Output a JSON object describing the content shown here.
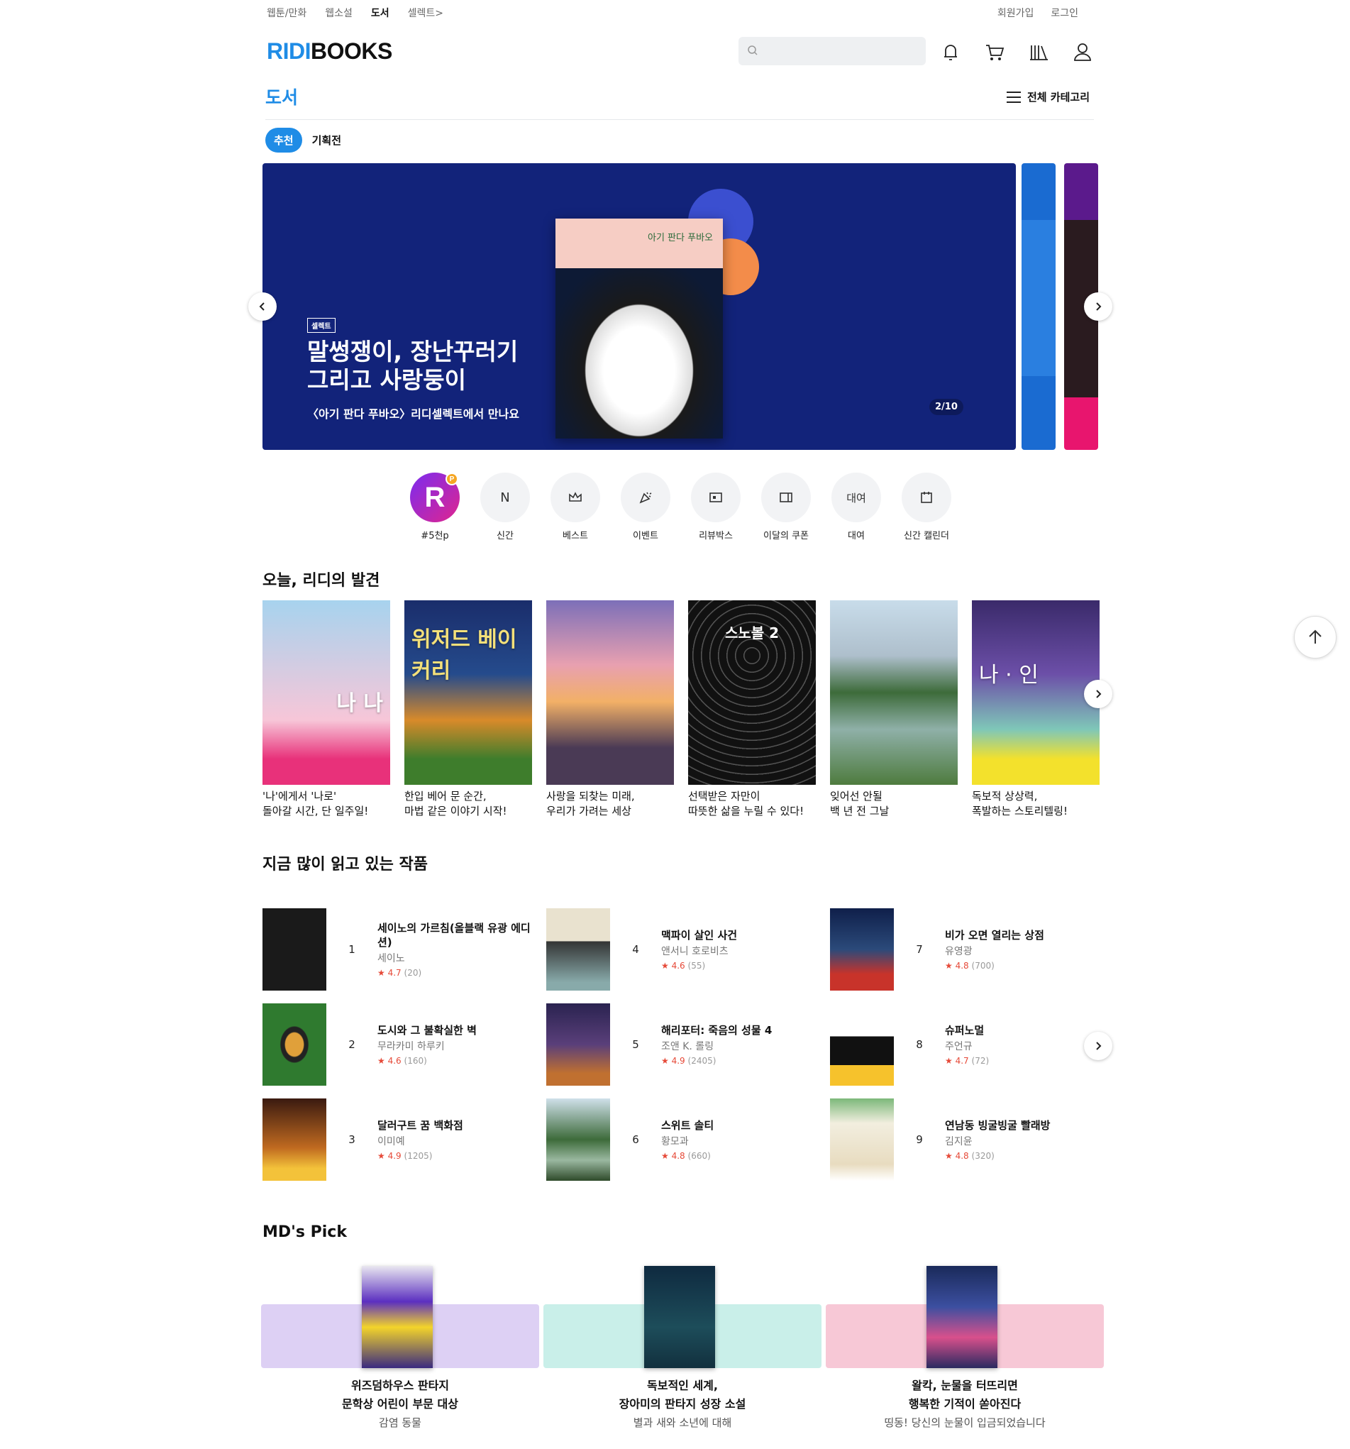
{
  "topnav": {
    "items": [
      "웹툰/만화",
      "웹소설",
      "도서",
      "셀렉트>"
    ],
    "auth": [
      "회원가입",
      "로그인"
    ]
  },
  "logo": {
    "ridi": "RIDI",
    "books": "BOOKS"
  },
  "search": {
    "placeholder": ""
  },
  "header_icons": [
    "bell-icon",
    "cart-icon",
    "library-icon",
    "user-icon"
  ],
  "page": {
    "title": "도서",
    "all_categories": "전체 카테고리"
  },
  "tabs": {
    "active": "추천",
    "other": "기획전"
  },
  "banner": {
    "badge": "셀렉트",
    "title_line1": "말썽쟁이, 장난꾸러기",
    "title_line2": "그리고 사랑둥이",
    "subtitle": "〈아기 판다 푸바오〉리디셀렉트에서 만나요",
    "book_title": "아기 판다 푸바오",
    "pager": "2/10",
    "colors": {
      "bg": "#12237a"
    }
  },
  "quick_menu": [
    {
      "icon": "R",
      "label": "#5천p"
    },
    {
      "icon": "N",
      "label": "신간"
    },
    {
      "icon": "crown-icon",
      "label": "베스트"
    },
    {
      "icon": "party-icon",
      "label": "이벤트"
    },
    {
      "icon": "review-icon",
      "label": "리뷰박스"
    },
    {
      "icon": "coupon-icon",
      "label": "이달의 쿠폰"
    },
    {
      "icon": "대여",
      "label": "대여"
    },
    {
      "icon": "calendar-icon",
      "label": "신간 캘린더"
    }
  ],
  "discovery": {
    "title": "오늘, 리디의 발견",
    "items": [
      {
        "cover_text": "나 나",
        "line1": "'나'에게서 '나로'",
        "line2": "돌아갈 시간, 단 일주일!"
      },
      {
        "cover_text": "위저드 베이커리",
        "line1": "한입 베어 문 순간,",
        "line2": "마법 같은 이야기 시작!"
      },
      {
        "cover_text": "",
        "line1": "사랑을 되찾는 미래,",
        "line2": "우리가 가려는 세상"
      },
      {
        "cover_text": "스노볼 2",
        "line1": "선택받은 자만이",
        "line2": "따뜻한 삶을 누릴 수 있다!"
      },
      {
        "cover_text": "",
        "line1": "잊어선 안될",
        "line2": "백 년 전 그날"
      },
      {
        "cover_text": "나 · 인",
        "line1": "독보적 상상력,",
        "line2": "폭발하는 스토리텔링!"
      }
    ]
  },
  "ranking": {
    "title": "지금 많이 읽고 있는 작품",
    "items": [
      {
        "rank": "1",
        "title": "세이노의 가르침(올블랙 유광 에디션)",
        "author": "세이노",
        "rating": "4.7",
        "count": "(20)"
      },
      {
        "rank": "4",
        "title": "맥파이 살인 사건",
        "author": "앤서니 호로비츠",
        "rating": "4.6",
        "count": "(55)"
      },
      {
        "rank": "7",
        "title": "비가 오면 열리는 상점",
        "author": "유영광",
        "rating": "4.8",
        "count": "(700)"
      },
      {
        "rank": "2",
        "title": "도시와 그 불확실한 벽",
        "author": "무라카미 하루키",
        "rating": "4.6",
        "count": "(160)"
      },
      {
        "rank": "5",
        "title": "해리포터: 죽음의 성물 4",
        "author": "조앤 K. 롤링",
        "rating": "4.9",
        "count": "(2405)"
      },
      {
        "rank": "8",
        "title": "슈퍼노멀",
        "author": "주언규",
        "rating": "4.7",
        "count": "(72)"
      },
      {
        "rank": "3",
        "title": "달러구트 꿈 백화점",
        "author": "이미예",
        "rating": "4.9",
        "count": "(1205)"
      },
      {
        "rank": "6",
        "title": "스위트 솔티",
        "author": "황모과",
        "rating": "4.8",
        "count": "(660)"
      },
      {
        "rank": "9",
        "title": "연남동 빙굴빙굴 빨래방",
        "author": "김지윤",
        "rating": "4.8",
        "count": "(320)"
      }
    ]
  },
  "mdpick": {
    "title": "MD's Pick",
    "items": [
      {
        "line1": "위즈덤하우스 판타지",
        "line2": "문학상 어린이 부문 대상",
        "sub": "감염 동물",
        "color": "#ddd0f4"
      },
      {
        "line1": "독보적인 세계,",
        "line2": "장아미의 판타지 성장 소설",
        "sub": "별과 새와 소년에 대해",
        "color": "#c9efe9"
      },
      {
        "line1": "왈칵, 눈물을 터뜨리면",
        "line2": "행복한 기적이 쏟아진다",
        "sub": "띵동! 당신의 눈물이 입금되었습니다",
        "color": "#f7c8d6"
      }
    ]
  }
}
